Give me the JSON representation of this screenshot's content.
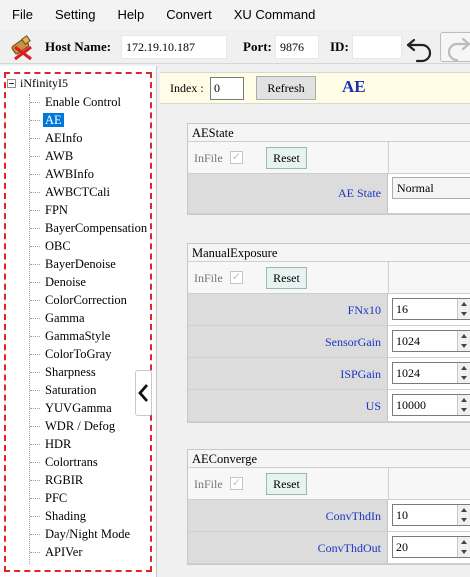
{
  "menu": [
    "File",
    "Setting",
    "Help",
    "Convert",
    "XU Command"
  ],
  "toolbar": {
    "host_label": "Host Name:",
    "host_value": "172.19.10.187",
    "port_label": "Port:",
    "port_value": "9876",
    "id_label": "ID:",
    "id_value": ""
  },
  "tree": {
    "root": "iNfinityI5",
    "items": [
      "Enable Control",
      "AE",
      "AEInfo",
      "AWB",
      "AWBInfo",
      "AWBCTCali",
      "FPN",
      "BayerCompensation",
      "OBC",
      "BayerDenoise",
      "Denoise",
      "ColorCorrection",
      "Gamma",
      "GammaStyle",
      "ColorToGray",
      "Sharpness",
      "Saturation",
      "YUVGamma",
      "WDR / Defog",
      "HDR",
      "Colortrans",
      "RGBIR",
      "PFC",
      "Shading",
      "Day/Night Mode",
      "APIVer"
    ],
    "selected": "AE"
  },
  "content": {
    "index_label": "Index :",
    "index_value": "0",
    "refresh_label": "Refresh",
    "title": "AE",
    "infile_label": "InFile",
    "reset_label": "Reset",
    "groups": {
      "aestate": {
        "title": "AEState",
        "rows": [
          {
            "name": "AE State",
            "value": "Normal"
          }
        ]
      },
      "manual": {
        "title": "ManualExposure",
        "rows": [
          {
            "name": "FNx10",
            "value": "16"
          },
          {
            "name": "SensorGain",
            "value": "1024"
          },
          {
            "name": "ISPGain",
            "value": "1024"
          },
          {
            "name": "US",
            "value": "10000"
          }
        ]
      },
      "converge": {
        "title": "AEConverge",
        "rows": [
          {
            "name": "ConvThdIn",
            "value": "10"
          },
          {
            "name": "ConvThdOut",
            "value": "20"
          }
        ]
      }
    }
  },
  "colors": {
    "accent": "#1a35c2",
    "dashed_border": "#e0242a",
    "selection": "#0078d7"
  }
}
